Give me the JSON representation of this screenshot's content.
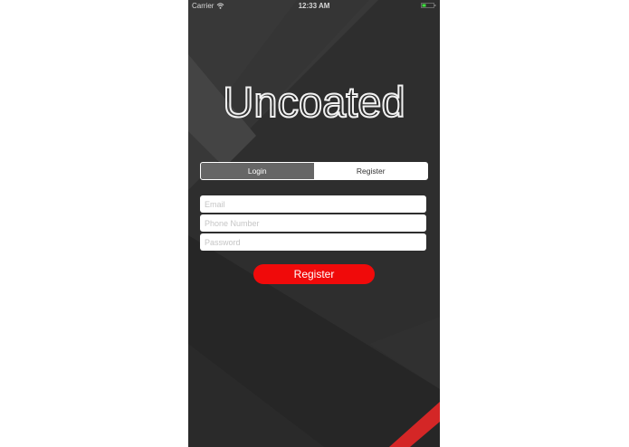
{
  "status_bar": {
    "carrier": "Carrier",
    "time": "12:33 AM"
  },
  "app": {
    "logo_text": "Uncoated"
  },
  "segmented_control": {
    "login_label": "Login",
    "register_label": "Register",
    "selected": "Login"
  },
  "form": {
    "email_placeholder": "Email",
    "phone_placeholder": "Phone Number",
    "password_placeholder": "Password",
    "email_value": "",
    "phone_value": "",
    "password_value": ""
  },
  "actions": {
    "register_button_label": "Register"
  },
  "colors": {
    "background": "#2e2e2e",
    "accent_red": "#f00a0a",
    "segment_active": "#666666",
    "battery_green": "#3ee13e"
  }
}
